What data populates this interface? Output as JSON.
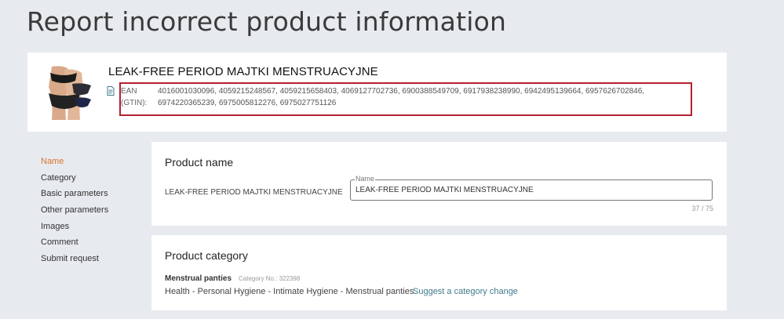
{
  "page": {
    "title": "Report incorrect product information"
  },
  "product": {
    "title": "LEAK-FREE PERIOD MAJTKI MENSTRUACYJNE",
    "ean_label": "EAN (GTIN):",
    "ean_values": "4016001030096, 4059215248567, 4059215658403, 4069127702736, 6900388549709, 6917938238990, 6942495139664, 6957626702846, 6974220365239, 6975005812276, 6975027751126",
    "highlight_color": "#b5202e"
  },
  "side_nav": {
    "items": [
      {
        "label": "Name",
        "active": true
      },
      {
        "label": "Category"
      },
      {
        "label": "Basic parameters"
      },
      {
        "label": "Other parameters"
      },
      {
        "label": "Images"
      },
      {
        "label": "Comment"
      },
      {
        "label": "Submit request"
      }
    ],
    "active_color": "#d9742c"
  },
  "name_section": {
    "title": "Product name",
    "current_value": "LEAK-FREE PERIOD MAJTKI MENSTRUACYJNE",
    "field_label": "Name",
    "field_value": "LEAK-FREE PERIOD MAJTKI MENSTRUACYJNE",
    "counter": "37 / 75"
  },
  "category_section": {
    "title": "Product category",
    "category_name": "Menstrual panties",
    "category_no": "Category No.: 322398",
    "path": "Health - Personal Hygiene - Intimate Hygiene - Menstrual panties",
    "suggest_link": "Suggest a category change",
    "link_color": "#3f7a8c"
  }
}
